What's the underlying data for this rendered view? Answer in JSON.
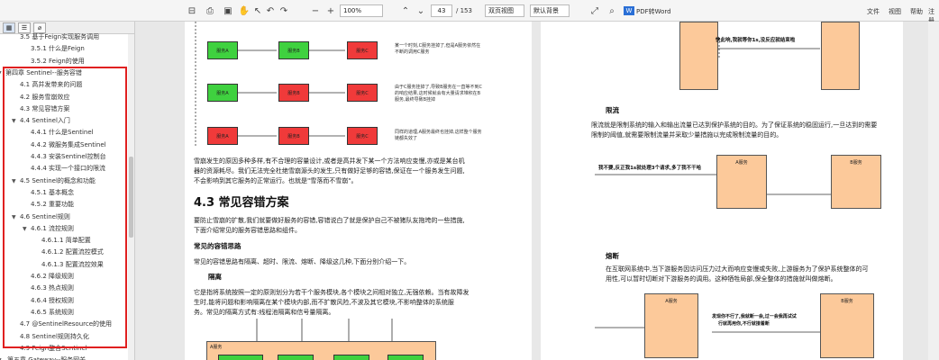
{
  "toolbar": {
    "zoom": "100%",
    "page_current": "43",
    "page_total": "/ 153",
    "view_double": "双页视图",
    "view_bg": "默认背景",
    "pdf_to_word": "PDF转Word",
    "menu_file": "文件",
    "menu_view": "视图",
    "menu_help": "帮助",
    "menu_register": "注册"
  },
  "toc": {
    "items": [
      {
        "label": "3.5 基于Feign实现服务调用"
      },
      {
        "label": "3.5.1 什么是Feign"
      },
      {
        "label": "3.5.2 Feign的使用"
      },
      {
        "label": "第四章 Sentinel--服务容错"
      },
      {
        "label": "4.1 高并发带来的问题"
      },
      {
        "label": "4.2 服务雪崩效应"
      },
      {
        "label": "4.3 常见容错方案"
      },
      {
        "label": "4.4 Sentinel入门"
      },
      {
        "label": "4.4.1 什么是Sentinel"
      },
      {
        "label": "4.4.2 微服务集成Sentinel"
      },
      {
        "label": "4.4.3 安装Sentinel控制台"
      },
      {
        "label": "4.4.4 实现一个接口的限流"
      },
      {
        "label": "4.5 Sentinel的概念和功能"
      },
      {
        "label": "4.5.1 基本概念"
      },
      {
        "label": "4.5.2 重要功能"
      },
      {
        "label": "4.6 Sentinel规则"
      },
      {
        "label": "4.6.1 流控规则"
      },
      {
        "label": "4.6.1.1 简单配置"
      },
      {
        "label": "4.6.1.2 配置流控模式"
      },
      {
        "label": "4.6.1.3 配置流控效果"
      },
      {
        "label": "4.6.2 降级规则"
      },
      {
        "label": "4.6.3 热点规则"
      },
      {
        "label": "4.6.4 授权规则"
      },
      {
        "label": "4.6.5 系统规则"
      },
      {
        "label": "4.7 @SentinelResource的使用"
      },
      {
        "label": "4.8 Sentinel规则持久化"
      },
      {
        "label": "4.9 Feign整合Sentinel"
      },
      {
        "label": "第五章 Gateway--服务网关"
      }
    ]
  },
  "page1": {
    "svc_a": "服务A",
    "svc_b": "服务B",
    "svc_c": "服务C",
    "note1": "某一个时刻,C服务挂掉了,但是A服务依然在不断的调用C服务",
    "note2": "由于C服务挂掉了,导致B服务在一直等不到C的响应结果,这时候就会有大量请求堆积在B服务,最终导致B挂掉",
    "note3": "同样的道理,A服务最终也挂掉,这样整个服务链都失效了",
    "para1_l1": "雪崩发生的原因多种多样,有不合理的容量设计,或者是高并发下某一个方法响应变慢,亦或是某台机",
    "para1_l2": "器的资源耗尽。我们无法完全杜绝雪崩源头的发生,只有做好足够的容错,保证在一个服务发生问题,",
    "para1_l3": "不会影响到其它服务的正常运行。也就是\"雪落而不雪崩\"。",
    "heading": "4.3 常见容错方案",
    "para2_l1": "要防止雪崩的扩散,我们就要做好服务的容错,容错说白了就是保护自己不被猪队友拖垮的一些措施,",
    "para2_l2": "下面介绍常见的服务容错思路和组件。",
    "sub_heading": "常见的容错思路",
    "para3": "常见的容错思路有隔离、超时、限流、熔断、降级这几种,下面分别介绍一下。",
    "isolation": "隔离",
    "para4_l1": "它是指将系统按照一定的原则划分为若干个服务模块,各个模块之间相对独立,无强依赖。当有故障发",
    "para4_l2": "生时,能将问题和影响隔离在某个模块内部,而不扩散风险,不波及其它模块,不影响整体的系统服",
    "para4_l3": "务。常见的隔离方式有:线程池隔离和信号量隔离。",
    "bottom_box": "A服务"
  },
  "page2": {
    "timeout_label": "快此响,我就等你1s,没反应就结束啦",
    "limit_heading": "限流",
    "limit_l1": "限流就是限制系统的输入和输出流量已达到保护系统的目的。为了保证系统的稳固运行,一旦达到的需要",
    "limit_l2": "限制的阈值,就需要限制流量并采取少量措施以完成限制流量的目的。",
    "limit_label": "我不要,反正我1s就处理3个请求,多了我不干哈",
    "svc_a": "A服务",
    "svc_b": "B服务",
    "fuse_heading": "熔断",
    "fuse_l1": "在互联网系统中,当下游服务因访问压力过大而响应变慢或失败,上游服务为了保护系统整体的可",
    "fuse_l2": "用性,可以暂时切断对下游服务的调用。这种牺牲局部,保全整体的措施就叫做熔断。",
    "fuse_label1": "发现你不行了,我就断一会,过一会我再试试",
    "fuse_label2": "行就再用你,不行就接着断"
  }
}
